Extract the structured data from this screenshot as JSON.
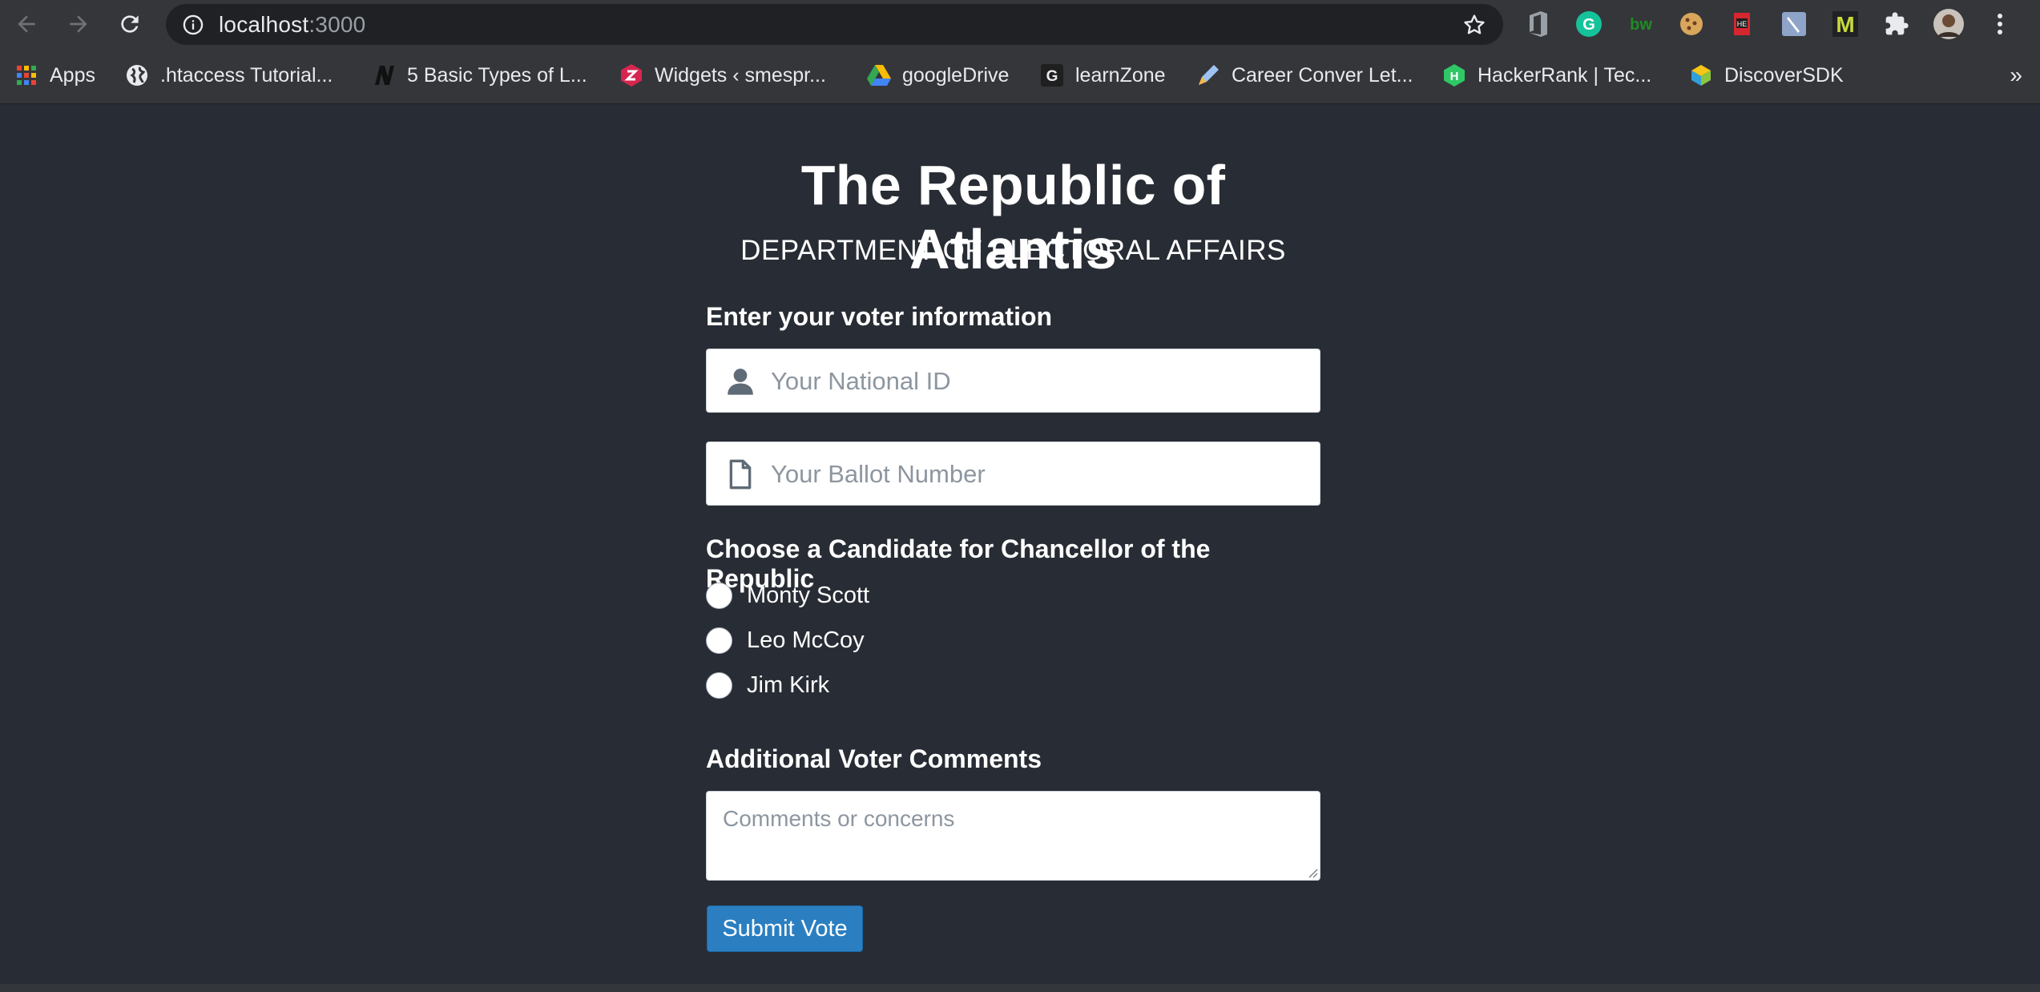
{
  "browser": {
    "url_host": "localhost",
    "url_port": ":3000",
    "bookmarks": [
      {
        "label": "Apps",
        "icon": "apps-grid-icon"
      },
      {
        "label": ".htaccess Tutorial...",
        "icon": "globe-icon"
      },
      {
        "label": "5 Basic Types of L...",
        "icon": "n-logo-icon"
      },
      {
        "label": "Widgets ‹ smespr...",
        "icon": "smespr-logo-icon"
      },
      {
        "label": "googleDrive",
        "icon": "google-drive-icon"
      },
      {
        "label": "learnZone",
        "icon": "g-logo-icon"
      },
      {
        "label": "Career Conver Let...",
        "icon": "pen-icon"
      },
      {
        "label": "HackerRank | Tec...",
        "icon": "hackerrank-icon"
      },
      {
        "label": "DiscoverSDK",
        "icon": "discoversdk-icon"
      }
    ],
    "more_label": "»"
  },
  "page": {
    "title": "The Republic of Atlantis",
    "subtitle": "DEPARTMENT OF ELECTORAL AFFAIRS",
    "voter_section_label": "Enter your voter information",
    "national_id_placeholder": "Your National ID",
    "ballot_number_placeholder": "Your Ballot Number",
    "candidate_section_label": "Choose a Candidate for Chancellor of the Republic",
    "candidates": [
      "Monty Scott",
      "Leo McCoy",
      "Jim Kirk"
    ],
    "comments_label": "Additional Voter Comments",
    "comments_placeholder": "Comments or concerns",
    "submit_label": "Submit Vote"
  },
  "colors": {
    "page_background": "#282c34",
    "chrome_background": "#35363a",
    "submit_button": "#2b7fc1",
    "placeholder_text": "#8d96a0"
  }
}
